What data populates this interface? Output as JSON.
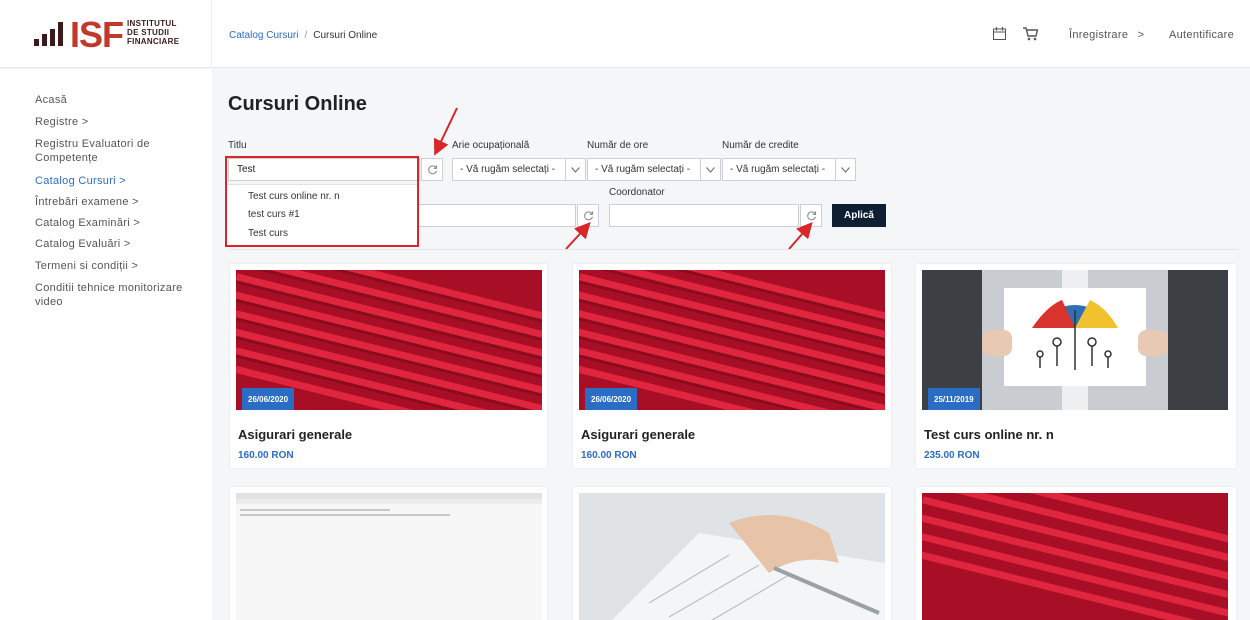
{
  "logo": {
    "mark": "ISF",
    "lines": [
      "INSTITUTUL",
      "DE STUDII",
      "FINANCIARE"
    ]
  },
  "breadcrumb": {
    "parent": "Catalog Cursuri",
    "separator": "/",
    "current": "Cursuri Online"
  },
  "header": {
    "icons": [
      "calendar-icon",
      "cart-icon"
    ],
    "register_label": "Înregistrare",
    "register_chevron": ">",
    "login_label": "Autentificare"
  },
  "sidebar": {
    "items": [
      {
        "label": "Acasă",
        "active": false
      },
      {
        "label": "Registre >",
        "active": false
      },
      {
        "label": "Registru Evaluatori de",
        "active": false
      },
      {
        "label": "Competențe",
        "active": false
      },
      {
        "label": "Catalog Cursuri >",
        "active": true
      },
      {
        "label": "Întrebări examene >",
        "active": false
      },
      {
        "label": "Catalog Examinări >",
        "active": false
      },
      {
        "label": "Catalog Evaluări >",
        "active": false
      },
      {
        "label": "Termeni si condiții >",
        "active": false
      },
      {
        "label": "Conditii tehnice monitorizare",
        "active": false
      },
      {
        "label": "video",
        "active": false
      }
    ]
  },
  "page": {
    "title": "Cursuri Online"
  },
  "filters": {
    "title_label": "Titlu",
    "title_value": "Test",
    "area_label": "Arie ocupațională",
    "area_value": "- Vă rugăm selectați -",
    "hours_label": "Număr de ore",
    "hours_value": "- Vă rugăm selectați -",
    "credits_label": "Număr de credite",
    "credits_value": "- Vă rugăm selectați -",
    "coordinator_label": "Coordonator",
    "coordinator_value": "",
    "apply_label": "Aplică",
    "suggestions": [
      "Test curs online nr. n",
      "test curs #1",
      "Test curs"
    ]
  },
  "cards": [
    {
      "date": "26/06/2020",
      "title": "Asigurari generale",
      "price": "160.00 RON"
    },
    {
      "date": "26/06/2020",
      "title": "Asigurari generale",
      "price": "160.00 RON"
    },
    {
      "date": "25/11/2019",
      "title": "Test curs online nr. n",
      "price": "235.00 RON"
    }
  ],
  "colors": {
    "accent": "#2b6cc4",
    "brand_red": "#c0392b",
    "apply_bg": "#0f1f33",
    "annotation_red": "#d9262a"
  }
}
